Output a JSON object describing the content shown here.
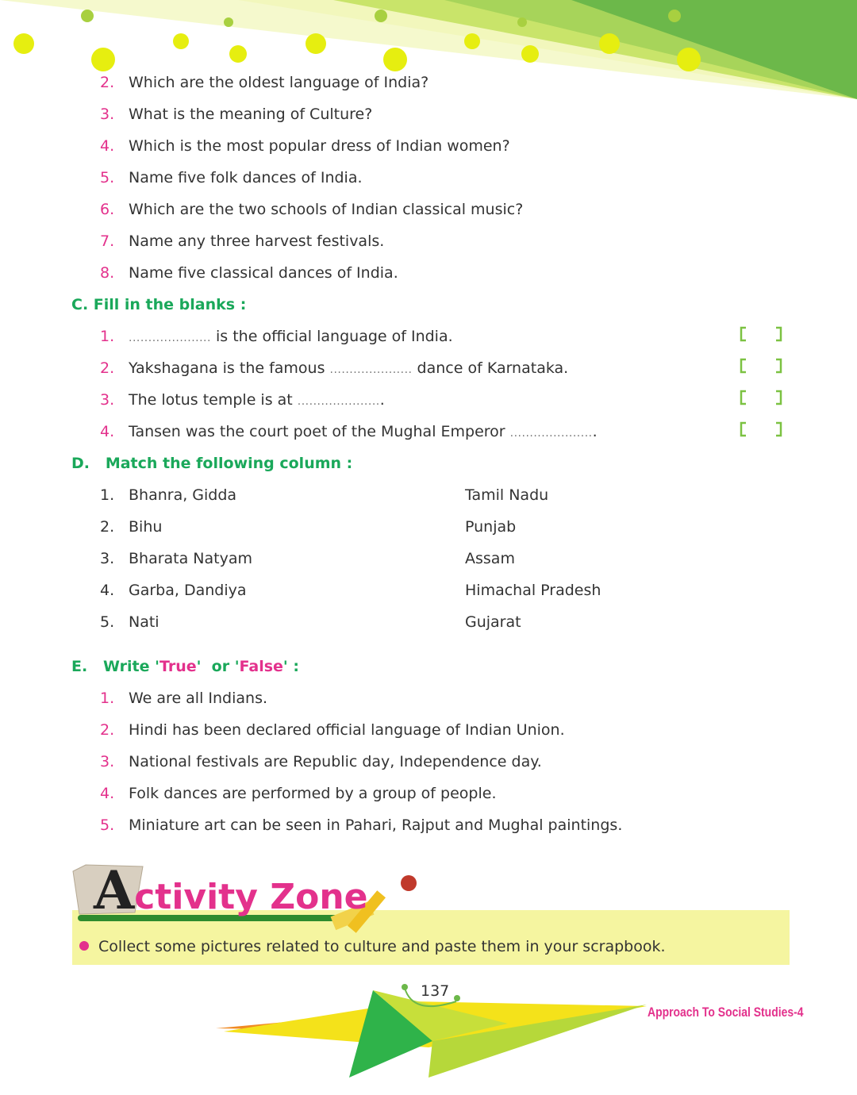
{
  "section_b_items": [
    {
      "num": "2.",
      "text": "Which are the oldest language of India?"
    },
    {
      "num": "3.",
      "text": "What is the meaning of Culture?"
    },
    {
      "num": "4.",
      "text": "Which is the most popular dress of Indian women?"
    },
    {
      "num": "5.",
      "text": "Name five folk dances of India."
    },
    {
      "num": "6.",
      "text": "Which are the two schools of Indian classical music?"
    },
    {
      "num": "7.",
      "text": "Name any three harvest festivals."
    },
    {
      "num": "8.",
      "text": "Name five classical dances of India."
    }
  ],
  "section_c": {
    "heading": "C. Fill in the blanks :",
    "blank": ".....................",
    "items": [
      {
        "num": "1.",
        "before": "",
        "after": " is the official language of India."
      },
      {
        "num": "2.",
        "before": "Yakshagana is the famous ",
        "after": " dance of Karnataka."
      },
      {
        "num": "3.",
        "before": "The lotus temple is at ",
        "after": "."
      },
      {
        "num": "4.",
        "before": "Tansen was the court poet of the Mughal Emperor ",
        "after": "."
      }
    ]
  },
  "section_d": {
    "heading": "D.   Match the following column :",
    "items": [
      {
        "num": "1.",
        "left": "Bhanra, Gidda",
        "right": "Tamil Nadu"
      },
      {
        "num": "2.",
        "left": "Bihu",
        "right": "Punjab"
      },
      {
        "num": "3.",
        "left": "Bharata Natyam",
        "right": "Assam"
      },
      {
        "num": "4.",
        "left": "Garba, Dandiya",
        "right": "Himachal Pradesh"
      },
      {
        "num": "5.",
        "left": "Nati",
        "right": "Gujarat"
      }
    ]
  },
  "section_e": {
    "heading_prefix": "E.   Write '",
    "heading_true": "True",
    "heading_mid": "'  or '",
    "heading_false": "False",
    "heading_suffix": "' :",
    "items": [
      {
        "num": "1.",
        "text": "We are all Indians."
      },
      {
        "num": "2.",
        "text": "Hindi has been declared official language of Indian Union."
      },
      {
        "num": "3.",
        "text": "National festivals are Republic day, Independence day."
      },
      {
        "num": "4.",
        "text": "Folk dances are performed by a group of people."
      },
      {
        "num": "5.",
        "text": "Miniature art can be seen in Pahari, Rajput and Mughal paintings."
      }
    ]
  },
  "activity": {
    "title_big": "A",
    "title_rest": "ctivity Zone",
    "text": "Collect some pictures related to culture and paste them in your scrapbook."
  },
  "footer": {
    "page_number": "137",
    "series": "Approach To Social Studies-4"
  },
  "colors": {
    "accent_green": "#1aa85a",
    "accent_pink": "#e3318c",
    "band_yellow": "#f5f5a0"
  }
}
